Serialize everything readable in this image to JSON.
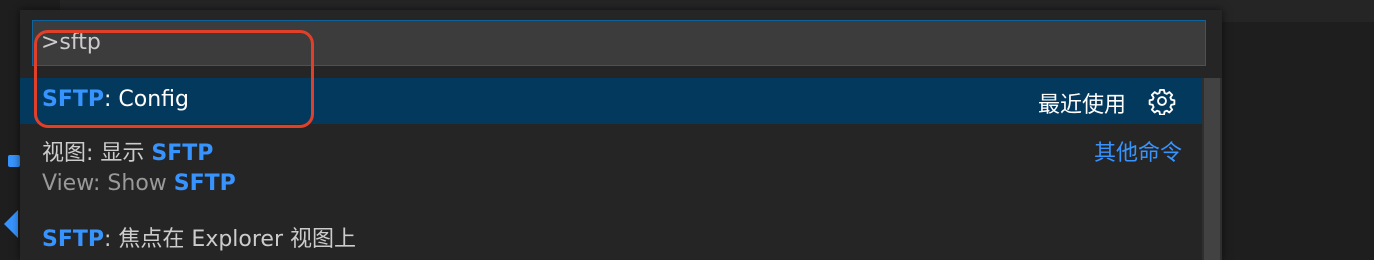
{
  "quick_open": {
    "input_value": ">sftp"
  },
  "results": [
    {
      "highlight": "SFTP",
      "rest": ": Config",
      "right_label": "最近使用",
      "right_icon": "gear-icon",
      "selected": true
    },
    {
      "prefix": "视图: 显示 ",
      "highlight": "SFTP",
      "detail_prefix": "View: Show ",
      "detail_highlight": "SFTP",
      "right_label": "其他命令"
    },
    {
      "highlight": "SFTP",
      "rest": ": 焦点在 Explorer 视图上"
    }
  ],
  "colors": {
    "accent": "#3794ff",
    "selection": "#04395e",
    "annotation": "#e0402a"
  }
}
